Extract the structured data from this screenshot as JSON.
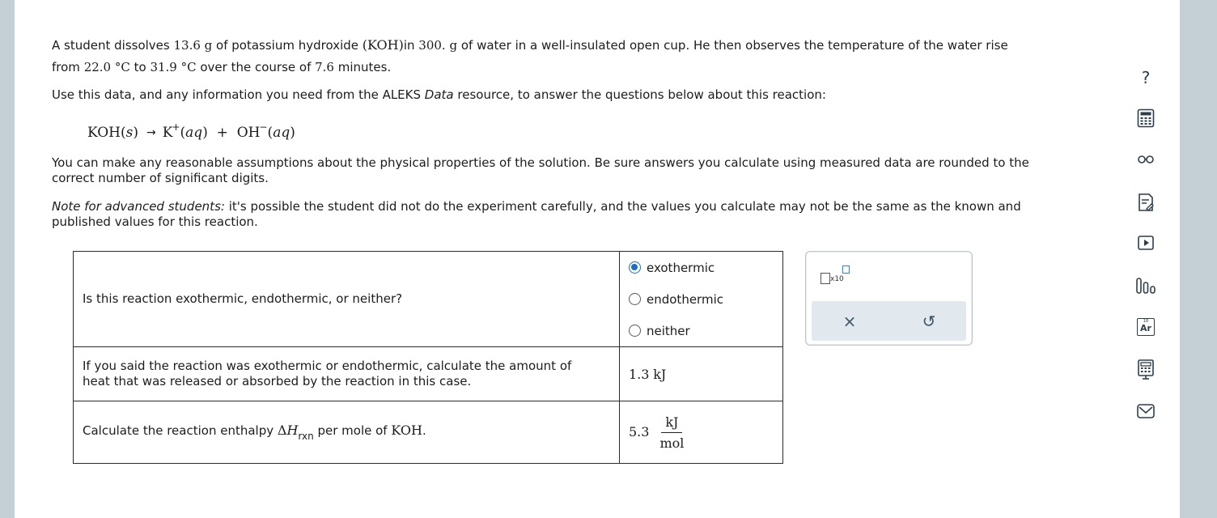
{
  "problem": {
    "p1_line1_pre": "A student dissolves ",
    "mass_koh": "13.6 g",
    "p1_line1_mid1": " of potassium hydroxide ",
    "formula_koh_paren": "(KOH)",
    "p1_line1_mid2": "in ",
    "mass_water": "300. g",
    "p1_line1_post": " of water in a well-insulated open cup. He then observes the temperature of the water rise",
    "p1_line2_pre": "from ",
    "temp_initial": "22.0 °C",
    "p1_line2_mid1": " to ",
    "temp_final": "31.9 °C",
    "p1_line2_mid2": " over the course of ",
    "time_value": "7.6",
    "p1_line2_post": " minutes.",
    "p2_pre": "Use this data, and any information you need from the ALEKS ",
    "p2_italic": "Data",
    "p2_post": " resource, to answer the questions below about this reaction:",
    "eq_reactant": "KOH",
    "eq_state_s": "s",
    "eq_cation": "K",
    "eq_plus_charge": "+",
    "eq_state_aq": "aq",
    "eq_plus": "+",
    "eq_anion": "OH",
    "eq_minus_charge": "−",
    "p3_line1": "You can make any reasonable assumptions about the physical properties of the solution. Be sure answers you calculate using measured data are rounded to the",
    "p3_line2": "correct number of significant digits.",
    "p4_italic": "Note for advanced students:",
    "p4_line1_post": " it's possible the student did not do the experiment carefully, and the values you calculate may not be the same as the known and",
    "p4_line2": "published values for this reaction."
  },
  "questions": {
    "q1": "Is this reaction exothermic, endothermic, or neither?",
    "q1_options": [
      "exothermic",
      "endothermic",
      "neither"
    ],
    "q1_selected": "exothermic",
    "q2_line1": "If you said the reaction was exothermic or endothermic, calculate the amount of",
    "q2_line2": "heat that was released or absorbed by the reaction in this case.",
    "q2_answer": "1.3",
    "q2_unit": "kJ",
    "q3_pre": "Calculate the reaction enthalpy ",
    "q3_delta": "Δ",
    "q3_H": "H",
    "q3_sub": "rxn",
    "q3_post": " per mole of ",
    "q3_formula": "KOH",
    "q3_period": ".",
    "q3_answer": "5.3",
    "q3_unit_num": "kJ",
    "q3_unit_den": "mol"
  },
  "answer_tool": {
    "sci_notation_label": "x10",
    "clear_symbol": "×",
    "undo_symbol": "↺"
  },
  "sidebar": {
    "help_symbol": "?",
    "icons": [
      "help-icon",
      "calculator-icon",
      "glasses-icon",
      "notes-icon",
      "video-icon",
      "chart-icon",
      "periodic-table-icon",
      "calculator-reference-icon",
      "mail-icon"
    ],
    "periodic_symbol": "Ar",
    "periodic_number": "18",
    "accent_color": "#2c3e4c"
  },
  "colors": {
    "background": "#c5d0d6",
    "panel": "#ffffff",
    "radio_selected": "#1a6fc0",
    "toolbar": "#e2e9ee"
  }
}
